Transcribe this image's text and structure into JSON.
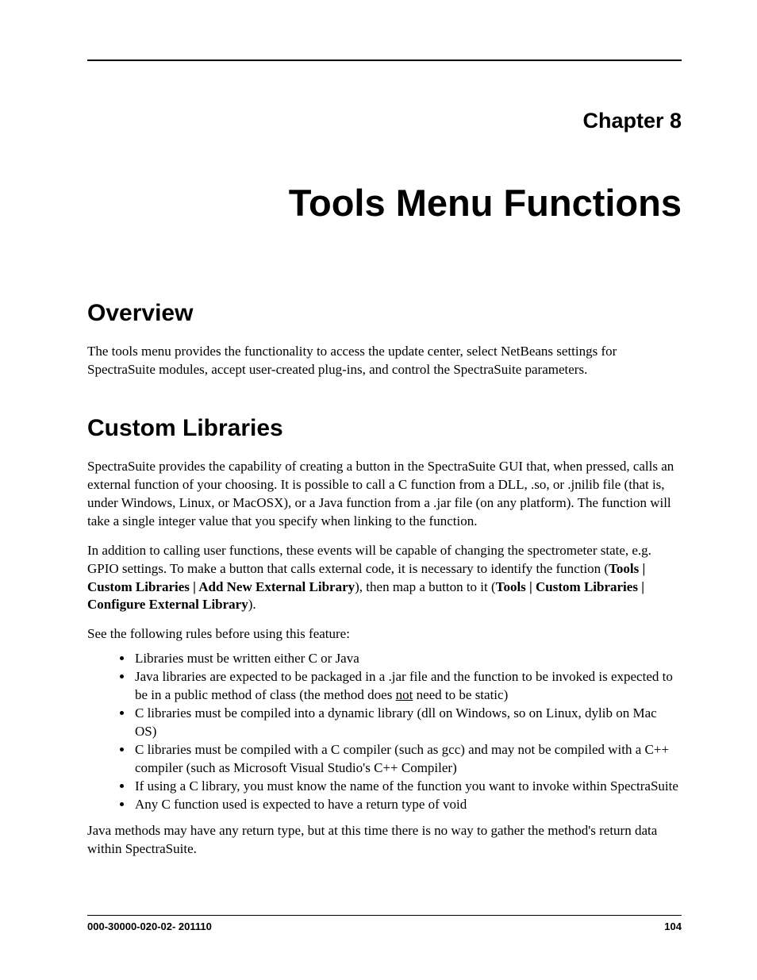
{
  "chapter_label": "Chapter 8",
  "title": "Tools Menu Functions",
  "sections": {
    "overview": {
      "heading": "Overview",
      "para": "The tools menu provides the functionality to access the update center, select NetBeans settings for SpectraSuite modules, accept user-created plug-ins, and control the SpectraSuite parameters."
    },
    "custom_libraries": {
      "heading": "Custom Libraries",
      "para1": "SpectraSuite provides the capability of creating a button in the SpectraSuite GUI that, when pressed, calls an external function of your choosing. It is possible to call a C function from a DLL, .so, or .jnilib file (that is, under Windows, Linux, or MacOSX), or a Java function from a .jar file (on any platform). The function will take a single integer value that you specify when linking to the function.",
      "para2_pre": "In addition to calling user functions, these events will be capable of changing the spectrometer state, e.g. GPIO settings. To make a button that calls external code, it is necessary to identify the function (",
      "para2_bold1": "Tools | Custom Libraries | Add New External Library",
      "para2_mid": "), then map a button to it (",
      "para2_bold2": "Tools | Custom Libraries | Configure External Library",
      "para2_post": ").",
      "rules_intro": "See the following rules before using this feature:",
      "rules": [
        "Libraries must be written either C or Java",
        "Java libraries are expected to be packaged in a .jar file and the function to be invoked is expected to be in a public method of class (the method does |UNDER|not|ENDUNDER| need to be static)",
        "C libraries must be compiled into a dynamic library (dll on Windows, so on Linux, dylib on Mac OS)",
        "C libraries must be compiled with a C compiler (such as gcc) and may not be compiled with a C++ compiler (such as Microsoft Visual Studio's C++ Compiler)",
        "If using a C library, you must know the name of the function you want to invoke within SpectraSuite",
        "Any C function used is expected to have a return type of void"
      ],
      "closing": "Java methods may have any return type, but at this time there is no way to gather the method's return data within SpectraSuite."
    }
  },
  "footer": {
    "doc_id": "000-30000-020-02- 201110",
    "page_number": "104"
  }
}
